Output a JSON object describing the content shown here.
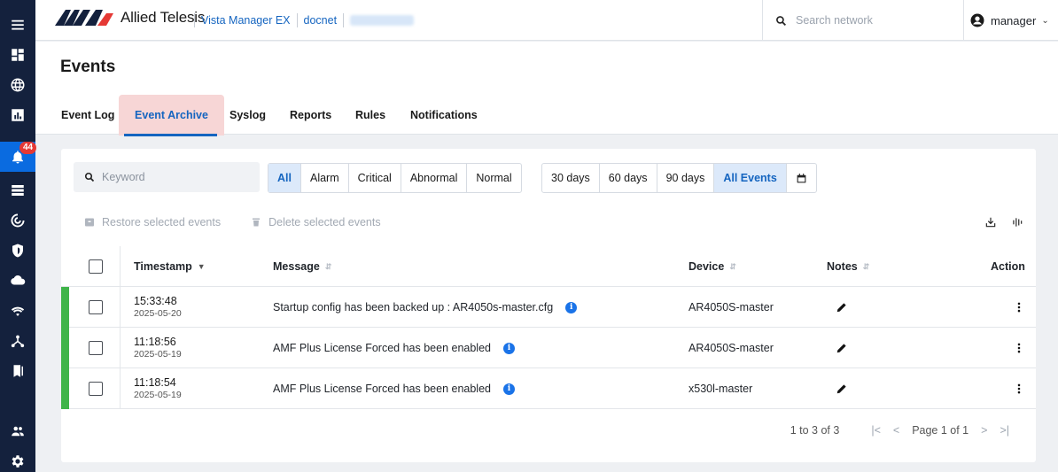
{
  "brand": {
    "name": "Allied Telesis"
  },
  "breadcrumb": {
    "app": "Vista Manager EX",
    "network": "docnet"
  },
  "search": {
    "placeholder": "Search network"
  },
  "user": {
    "name": "manager"
  },
  "rail": {
    "badge_count": "44"
  },
  "page": {
    "title": "Events"
  },
  "tabs": [
    {
      "label": "Event Log"
    },
    {
      "label": "Event Archive"
    },
    {
      "label": "Syslog"
    },
    {
      "label": "Reports"
    },
    {
      "label": "Rules"
    },
    {
      "label": "Notifications"
    }
  ],
  "filters": {
    "keyword_placeholder": "Keyword",
    "severity": [
      "All",
      "Alarm",
      "Critical",
      "Abnormal",
      "Normal"
    ],
    "severity_selected": "All",
    "range": [
      "30 days",
      "60 days",
      "90 days",
      "All Events"
    ],
    "range_selected": "All Events"
  },
  "actions": {
    "restore": "Restore selected events",
    "delete": "Delete selected events"
  },
  "table": {
    "headers": {
      "timestamp": "Timestamp",
      "message": "Message",
      "device": "Device",
      "notes": "Notes",
      "action": "Action"
    },
    "rows": [
      {
        "time": "15:33:48",
        "date": "2025-05-20",
        "message": "Startup config has been backed up : AR4050s-master.cfg",
        "device": "AR4050S-master",
        "status_color": "#3fb449"
      },
      {
        "time": "11:18:56",
        "date": "2025-05-19",
        "message": "AMF Plus License Forced has been enabled",
        "device": "AR4050S-master",
        "status_color": "#3fb449"
      },
      {
        "time": "11:18:54",
        "date": "2025-05-19",
        "message": "AMF Plus License Forced has been enabled",
        "device": "x530l-master",
        "status_color": "#3fb449"
      }
    ]
  },
  "pagination": {
    "summary": "1 to 3 of 3",
    "page_label": "Page 1 of 1"
  },
  "colors": {
    "accent": "#1565c0",
    "rail": "#14213d",
    "active_tab_bg": "#f7d6d6",
    "status_normal": "#3fb449"
  }
}
